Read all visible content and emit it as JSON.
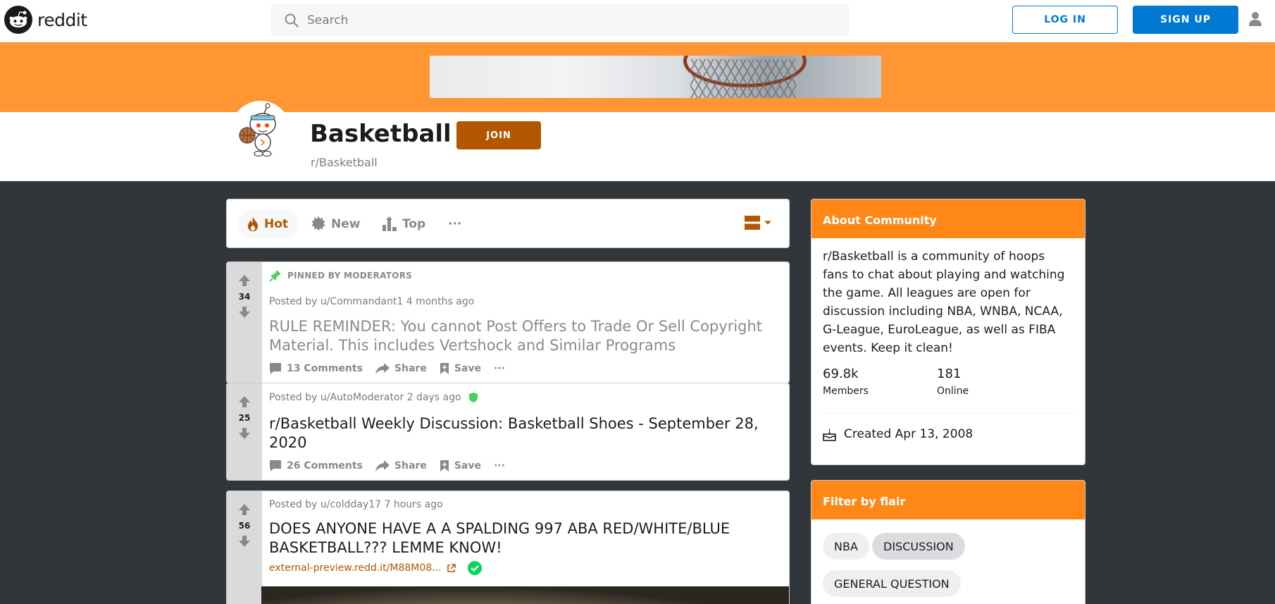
{
  "header": {
    "logo_text": "reddit",
    "search_placeholder": "Search",
    "login_label": "LOG IN",
    "signup_label": "SIGN UP"
  },
  "community": {
    "title": "Basketball",
    "name": "r/Basketball",
    "join_label": "JOIN"
  },
  "sort": {
    "hot": "Hot",
    "new": "New",
    "top": "Top",
    "more": "···"
  },
  "posts": [
    {
      "pinned_label": "PINNED BY MODERATORS",
      "score": "34",
      "meta": "Posted by u/Commandant1 4 months ago",
      "title": "RULE REMINDER: You cannot Post Offers to Trade Or Sell Copyright Material. This includes Vertshock and Similar Programs",
      "comments": "13 Comments",
      "share": "Share",
      "save": "Save"
    },
    {
      "score": "25",
      "meta": "Posted by u/AutoModerator 2 days ago",
      "title": "r/Basketball Weekly Discussion: Basketball Shoes - September 28, 2020",
      "comments": "26 Comments",
      "share": "Share",
      "save": "Save"
    },
    {
      "score": "56",
      "meta": "Posted by u/coldday17 7 hours ago",
      "title": "DOES ANYONE HAVE A A SPALDING 997 ABA RED/WHITE/BLUE BASKETBALL??? LEMME KNOW!",
      "link": "external-preview.redd.it/M88M08..."
    }
  ],
  "about": {
    "heading": "About Community",
    "description": "r/Basketball is a community of hoops fans to chat about playing and watching the game. All leagues are open for discussion including NBA, WNBA, NCAA, G-League, EuroLeague, as well as FIBA events. Keep it clean!",
    "members_count": "69.8k",
    "members_label": "Members",
    "online_count": "181",
    "online_label": "Online",
    "created": "Created Apr 13, 2008"
  },
  "flair": {
    "heading": "Filter by flair",
    "chips": [
      "NBA",
      "DISCUSSION",
      "GENERAL QUESTION"
    ]
  },
  "colors": {
    "brand_blue": "#0079d3",
    "banner_orange": "#ff9533",
    "card_header_orange": "#ff8717",
    "join_brown": "#b35600",
    "page_bg": "#30363a"
  }
}
